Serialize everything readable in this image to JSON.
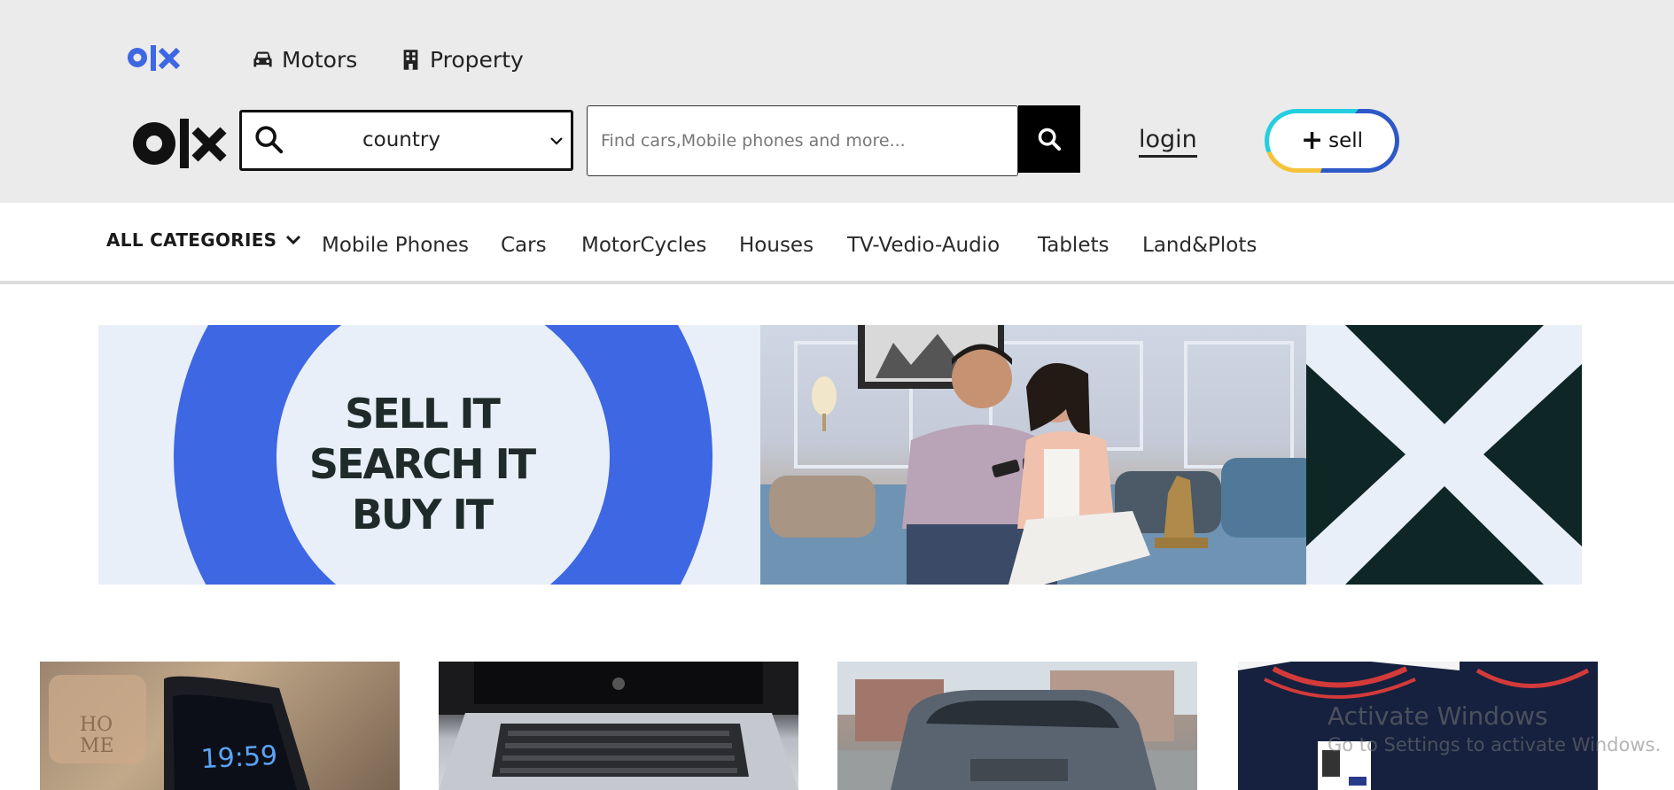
{
  "header": {
    "nav_links": [
      {
        "label": "Motors",
        "icon": "car-icon"
      },
      {
        "label": "Property",
        "icon": "building-icon"
      }
    ],
    "country_select": {
      "value": "country",
      "icon": "search-icon"
    },
    "search": {
      "placeholder": "Find cars,Mobile phones and more...",
      "button_icon": "search-icon"
    },
    "login_label": "login",
    "sell_label": "sell",
    "colors": {
      "brand_blue": "#3d67e3",
      "header_bg": "#ebebeb",
      "sell_yellow": "#f5c23a",
      "sell_cyan": "#23cee0",
      "sell_blue": "#2d58c7"
    }
  },
  "categories": {
    "all_label": "ALL CATEGORIES",
    "items": [
      "Mobile Phones",
      "Cars",
      "MotorCycles",
      "Houses",
      "TV-Vedio-Audio",
      "Tablets",
      "Land&Plots"
    ]
  },
  "banner": {
    "lines": [
      "SELL IT",
      "SEARCH IT",
      "BUY IT"
    ],
    "colors": {
      "ring": "#3d67e3",
      "dark_panel": "#0e2626"
    }
  },
  "cards": [
    {
      "name": "phone-listing",
      "clock_time": "19:59",
      "sign_text": "HOME"
    },
    {
      "name": "laptop-listing"
    },
    {
      "name": "car-listing"
    },
    {
      "name": "shirt-listing"
    }
  ],
  "watermark": {
    "title": "Activate Windows",
    "subtitle": "Go to Settings to activate Windows."
  }
}
